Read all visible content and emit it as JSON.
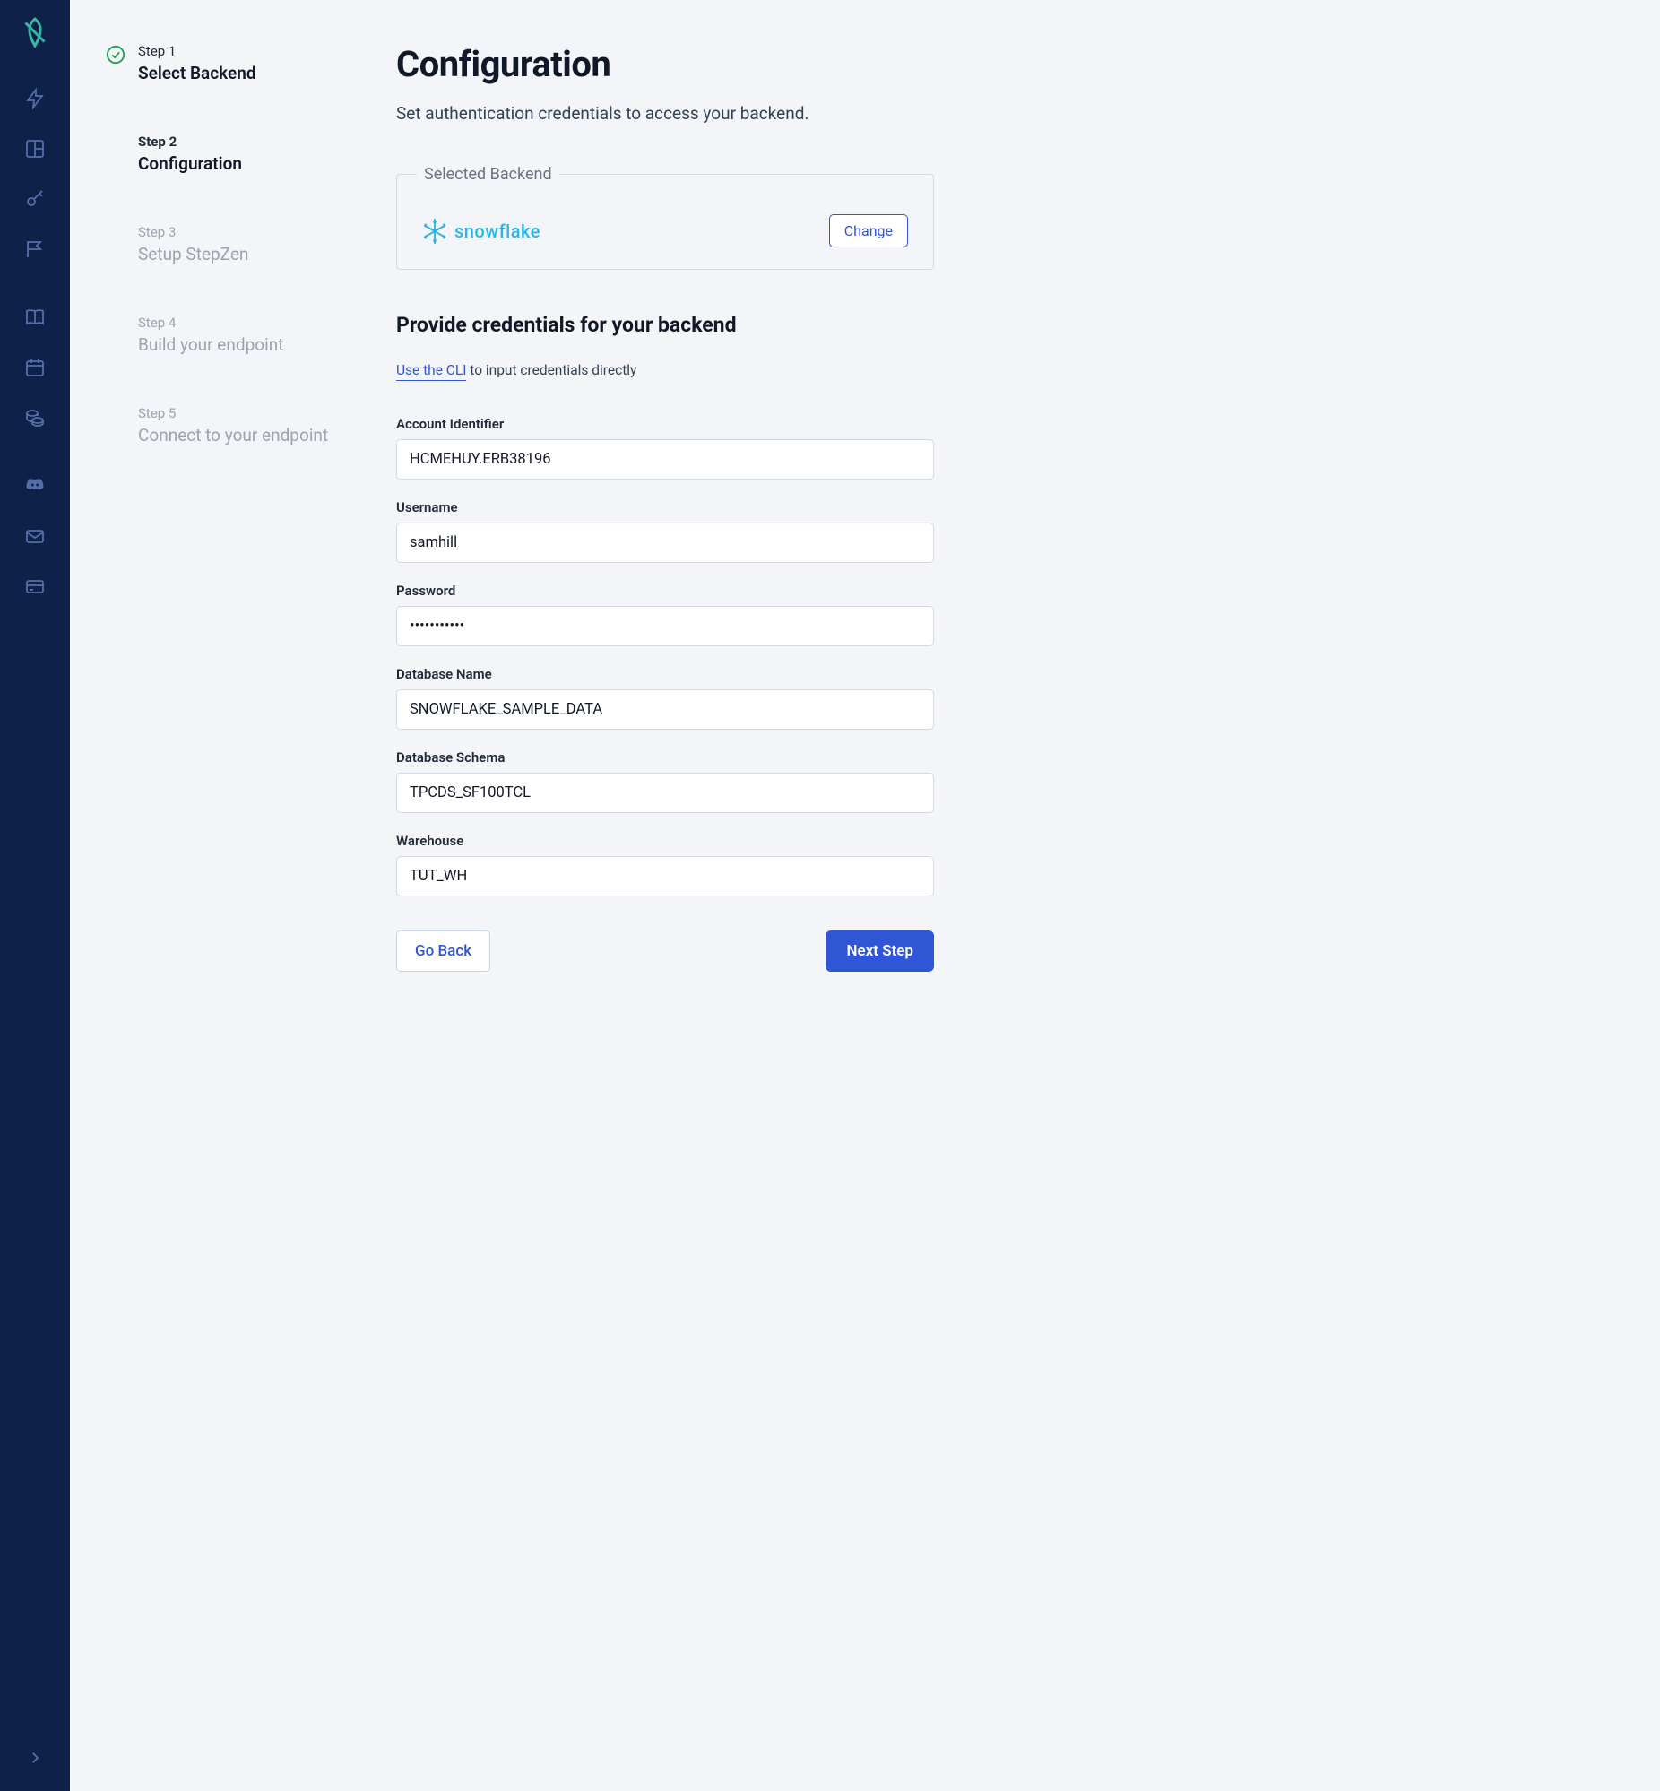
{
  "colors": {
    "sidebar_bg": "#0E2249",
    "accent": "#2F56D4",
    "logo": "#39B7A3",
    "snowflake": "#29B5E8"
  },
  "sidebar": {
    "icons_primary": [
      "lightning-icon",
      "layout-icon",
      "key-icon",
      "flag-icon"
    ],
    "icons_secondary": [
      "book-icon",
      "calendar-icon",
      "coins-icon"
    ],
    "icons_tertiary": [
      "discord-icon",
      "mail-icon",
      "card-icon"
    ],
    "expand_icon": "chevron-right-icon"
  },
  "steps": [
    {
      "label": "Step 1",
      "title": "Select Backend",
      "state": "done"
    },
    {
      "label": "Step 2",
      "title": "Configuration",
      "state": "current"
    },
    {
      "label": "Step 3",
      "title": "Setup StepZen",
      "state": "future"
    },
    {
      "label": "Step 4",
      "title": "Build your endpoint",
      "state": "future"
    },
    {
      "label": "Step 5",
      "title": "Connect to your endpoint",
      "state": "future"
    }
  ],
  "page": {
    "title": "Configuration",
    "subtitle": "Set authentication credentials to access your backend."
  },
  "selected_backend": {
    "legend": "Selected Backend",
    "name": "snowflake",
    "change_label": "Change"
  },
  "credentials": {
    "heading": "Provide credentials for your backend",
    "cli_link": "Use the CLI",
    "cli_rest": " to input credentials directly"
  },
  "fields": {
    "account_identifier": {
      "label": "Account Identifier",
      "value": "HCMEHUY.ERB38196"
    },
    "username": {
      "label": "Username",
      "value": "samhill"
    },
    "password": {
      "label": "Password",
      "value": "aaaaaaaaaaa"
    },
    "database_name": {
      "label": "Database Name",
      "value": "SNOWFLAKE_SAMPLE_DATA"
    },
    "database_schema": {
      "label": "Database Schema",
      "value": "TPCDS_SF100TCL"
    },
    "warehouse": {
      "label": "Warehouse",
      "value": "TUT_WH"
    }
  },
  "actions": {
    "back": "Go Back",
    "next": "Next Step"
  }
}
